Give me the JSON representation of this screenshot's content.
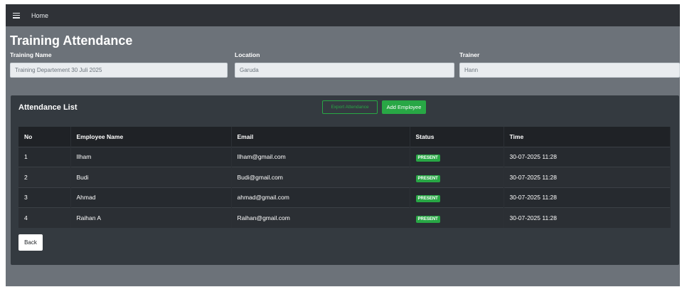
{
  "topbar": {
    "menu_icon": "hamburger-icon",
    "home_label": "Home"
  },
  "page": {
    "title": "Training Attendance"
  },
  "fields": {
    "training_name": {
      "label": "Training Name",
      "value": "Training  Departement 30 Juli 2025"
    },
    "location": {
      "label": "Location",
      "value": "Garuda"
    },
    "trainer": {
      "label": "Trainer",
      "value": "Hann"
    }
  },
  "card": {
    "title": "Attendance List",
    "export_label": "Export Attendance",
    "add_label": "Add Employee"
  },
  "table": {
    "headers": [
      "No",
      "Employee Name",
      "Email",
      "Status",
      "Time"
    ],
    "rows": [
      {
        "no": "1",
        "name": "Ilham",
        "email": "Ilham@gmail.com",
        "status": "PRESENT",
        "time": "30-07-2025 11:28"
      },
      {
        "no": "2",
        "name": "Budi",
        "email": "Budi@gmail.com",
        "status": "PRESENT",
        "time": "30-07-2025 11:28"
      },
      {
        "no": "3",
        "name": "Ahmad",
        "email": "ahmad@gmail.com",
        "status": "PRESENT",
        "time": "30-07-2025 11:28"
      },
      {
        "no": "4",
        "name": "Raihan A",
        "email": "Raihan@gmail.com",
        "status": "PRESENT",
        "time": "30-07-2025 11:28"
      }
    ]
  },
  "back_label": "Back",
  "colors": {
    "success": "#28a745",
    "card_bg": "#343a40",
    "page_bg": "#6c7279"
  }
}
